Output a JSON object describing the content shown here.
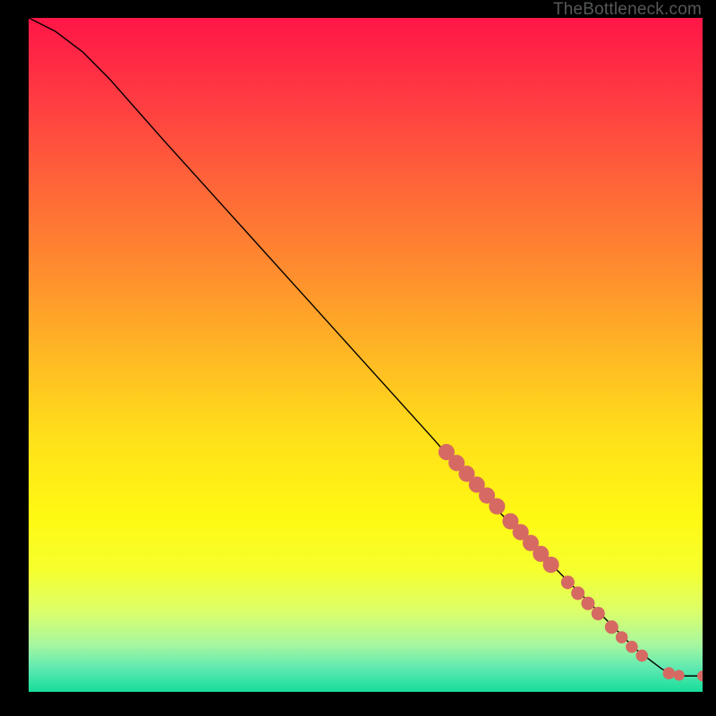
{
  "watermark": "TheBottleneck.com",
  "chart_data": {
    "type": "line",
    "title": "",
    "xlabel": "",
    "ylabel": "",
    "xlim": [
      0,
      100
    ],
    "ylim": [
      0,
      100
    ],
    "series": [
      {
        "name": "curve",
        "x": [
          0,
          4,
          8,
          12,
          20,
          30,
          40,
          50,
          60,
          68,
          72,
          76,
          80,
          84,
          88,
          90,
          94,
          96,
          98,
          100
        ],
        "y": [
          100,
          98,
          95,
          91,
          82,
          71,
          60,
          49,
          38,
          29,
          25,
          21,
          17,
          13,
          9,
          7,
          4,
          3,
          3,
          3
        ]
      }
    ],
    "markers": {
      "name": "highlighted-points",
      "color": "#d66a63",
      "points": [
        {
          "x": 62,
          "y": 36,
          "r": 1.2
        },
        {
          "x": 63.5,
          "y": 34.4,
          "r": 1.2
        },
        {
          "x": 65,
          "y": 32.8,
          "r": 1.2
        },
        {
          "x": 66.5,
          "y": 31.2,
          "r": 1.2
        },
        {
          "x": 68,
          "y": 29.6,
          "r": 1.2
        },
        {
          "x": 69.5,
          "y": 28,
          "r": 1.2
        },
        {
          "x": 71.5,
          "y": 25.8,
          "r": 1.2
        },
        {
          "x": 73,
          "y": 24.2,
          "r": 1.2
        },
        {
          "x": 74.5,
          "y": 22.6,
          "r": 1.2
        },
        {
          "x": 76,
          "y": 21,
          "r": 1.2
        },
        {
          "x": 77.5,
          "y": 19.4,
          "r": 1.2
        },
        {
          "x": 80,
          "y": 16.8,
          "r": 1.0
        },
        {
          "x": 81.5,
          "y": 15.2,
          "r": 1.0
        },
        {
          "x": 83,
          "y": 13.7,
          "r": 1.0
        },
        {
          "x": 84.5,
          "y": 12.2,
          "r": 1.0
        },
        {
          "x": 86.5,
          "y": 10.2,
          "r": 1.0
        },
        {
          "x": 88,
          "y": 8.7,
          "r": 0.9
        },
        {
          "x": 89.5,
          "y": 7.3,
          "r": 0.9
        },
        {
          "x": 91,
          "y": 6.0,
          "r": 0.9
        },
        {
          "x": 95,
          "y": 3.4,
          "r": 0.9
        },
        {
          "x": 96.5,
          "y": 3.1,
          "r": 0.8
        },
        {
          "x": 100,
          "y": 3.0,
          "r": 0.8
        }
      ]
    },
    "background_gradient": {
      "stops": [
        {
          "offset": 0.0,
          "color": "#ff1647"
        },
        {
          "offset": 0.12,
          "color": "#ff3b42"
        },
        {
          "offset": 0.25,
          "color": "#ff6638"
        },
        {
          "offset": 0.38,
          "color": "#ff8e2e"
        },
        {
          "offset": 0.5,
          "color": "#ffb824"
        },
        {
          "offset": 0.62,
          "color": "#ffdf1a"
        },
        {
          "offset": 0.74,
          "color": "#fff913"
        },
        {
          "offset": 0.82,
          "color": "#f5ff2e"
        },
        {
          "offset": 0.88,
          "color": "#dcff69"
        },
        {
          "offset": 0.93,
          "color": "#a7f7a0"
        },
        {
          "offset": 0.965,
          "color": "#5ee9b1"
        },
        {
          "offset": 1.0,
          "color": "#17dd9a"
        }
      ]
    }
  }
}
